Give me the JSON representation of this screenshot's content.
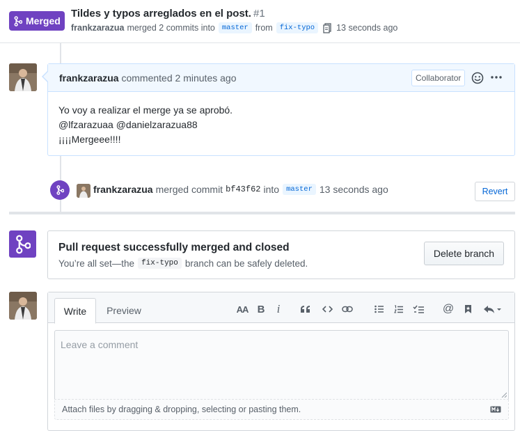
{
  "header": {
    "state_badge": "Merged",
    "title": "Tildes y typos arreglados en el post.",
    "number": "#1",
    "author": "frankzarazua",
    "merged_text": "merged 2 commits into",
    "base_branch": "master",
    "from_text": "from",
    "head_branch": "fix-typo",
    "time": "13 seconds ago"
  },
  "comment": {
    "author": "frankzarazua",
    "action": "commented",
    "time": "2 minutes ago",
    "role_label": "Collaborator",
    "body_lines": [
      "Yo voy a realizar el merge ya se aprobó.",
      "@lfzarazuaa @danielzarazua88",
      "¡¡¡¡Mergeee!!!!"
    ]
  },
  "merge_event": {
    "author": "frankzarazua",
    "action": "merged commit",
    "sha": "bf43f62",
    "into_text": "into",
    "branch": "master",
    "time": "13 seconds ago",
    "revert_label": "Revert"
  },
  "merge_status": {
    "title": "Pull request successfully merged and closed",
    "subtitle_before": "You’re all set—the",
    "branch": "fix-typo",
    "subtitle_after": "branch can be safely deleted.",
    "delete_button": "Delete branch"
  },
  "new_comment": {
    "tab_write": "Write",
    "tab_preview": "Preview",
    "placeholder": "Leave a comment",
    "attach_text": "Attach files by dragging & dropping, selecting or pasting them.",
    "toolbar": {
      "header_icon_text": "AA",
      "bold_icon_text": "B",
      "italic_icon_text": "i"
    }
  },
  "colors": {
    "merged_purple": "#6f42c1",
    "link_blue": "#0366d6",
    "comment_border": "#c8e1ff",
    "comment_header_bg": "#f1f8ff"
  }
}
